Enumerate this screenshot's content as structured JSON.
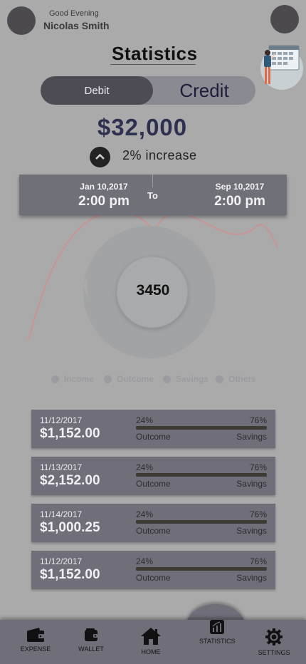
{
  "header": {
    "greeting": "Good Evening",
    "user_name": "Nicolas Smith",
    "title": "Statistics"
  },
  "toggle": {
    "debit_label": "Debit",
    "credit_label": "Credit",
    "selected": "Debit"
  },
  "summary": {
    "amount": "$32,000",
    "trend_text": "2% increase",
    "trend_icon": "chevron-up-icon"
  },
  "date_range": {
    "start_date": "Jan 10,2017",
    "start_time": "2:00 pm",
    "separator": "To",
    "end_date": "Sep 10,2017",
    "end_time": "2:00 pm"
  },
  "chart": {
    "center_value": "3450",
    "legend": [
      "Income",
      "Outcome",
      "Savings",
      "Others"
    ]
  },
  "transactions": [
    {
      "date": "11/12/2017",
      "amount": "$1,152.00",
      "left_pct": "24%",
      "right_pct": "76%",
      "left_label": "Outcome",
      "right_label": "Savings",
      "fill": 0.24
    },
    {
      "date": "11/13/2017",
      "amount": "$2,152.00",
      "left_pct": "24%",
      "right_pct": "76%",
      "left_label": "Outcome",
      "right_label": "Savings",
      "fill": 0.24
    },
    {
      "date": "11/14/2017",
      "amount": "$1,000.25",
      "left_pct": "24%",
      "right_pct": "76%",
      "left_label": "Outcome",
      "right_label": "Savings",
      "fill": 0.24
    },
    {
      "date": "11/12/2017",
      "amount": "$1,152.00",
      "left_pct": "24%",
      "right_pct": "76%",
      "left_label": "Outcome",
      "right_label": "Savings",
      "fill": 0.24
    }
  ],
  "nav": [
    {
      "label": "EXPENSE",
      "icon": "wallet-icon"
    },
    {
      "label": "WALLET",
      "icon": "wallet-card-icon"
    },
    {
      "label": "HOME",
      "icon": "home-icon"
    },
    {
      "label": "STATISTICS",
      "icon": "statistics-icon"
    },
    {
      "label": "SETTINGS",
      "icon": "gear-icon"
    }
  ],
  "colors": {
    "background": "#aaaaab",
    "card": "#6f6e79",
    "accent_text": "#2e3050",
    "curve": "#d79090"
  }
}
